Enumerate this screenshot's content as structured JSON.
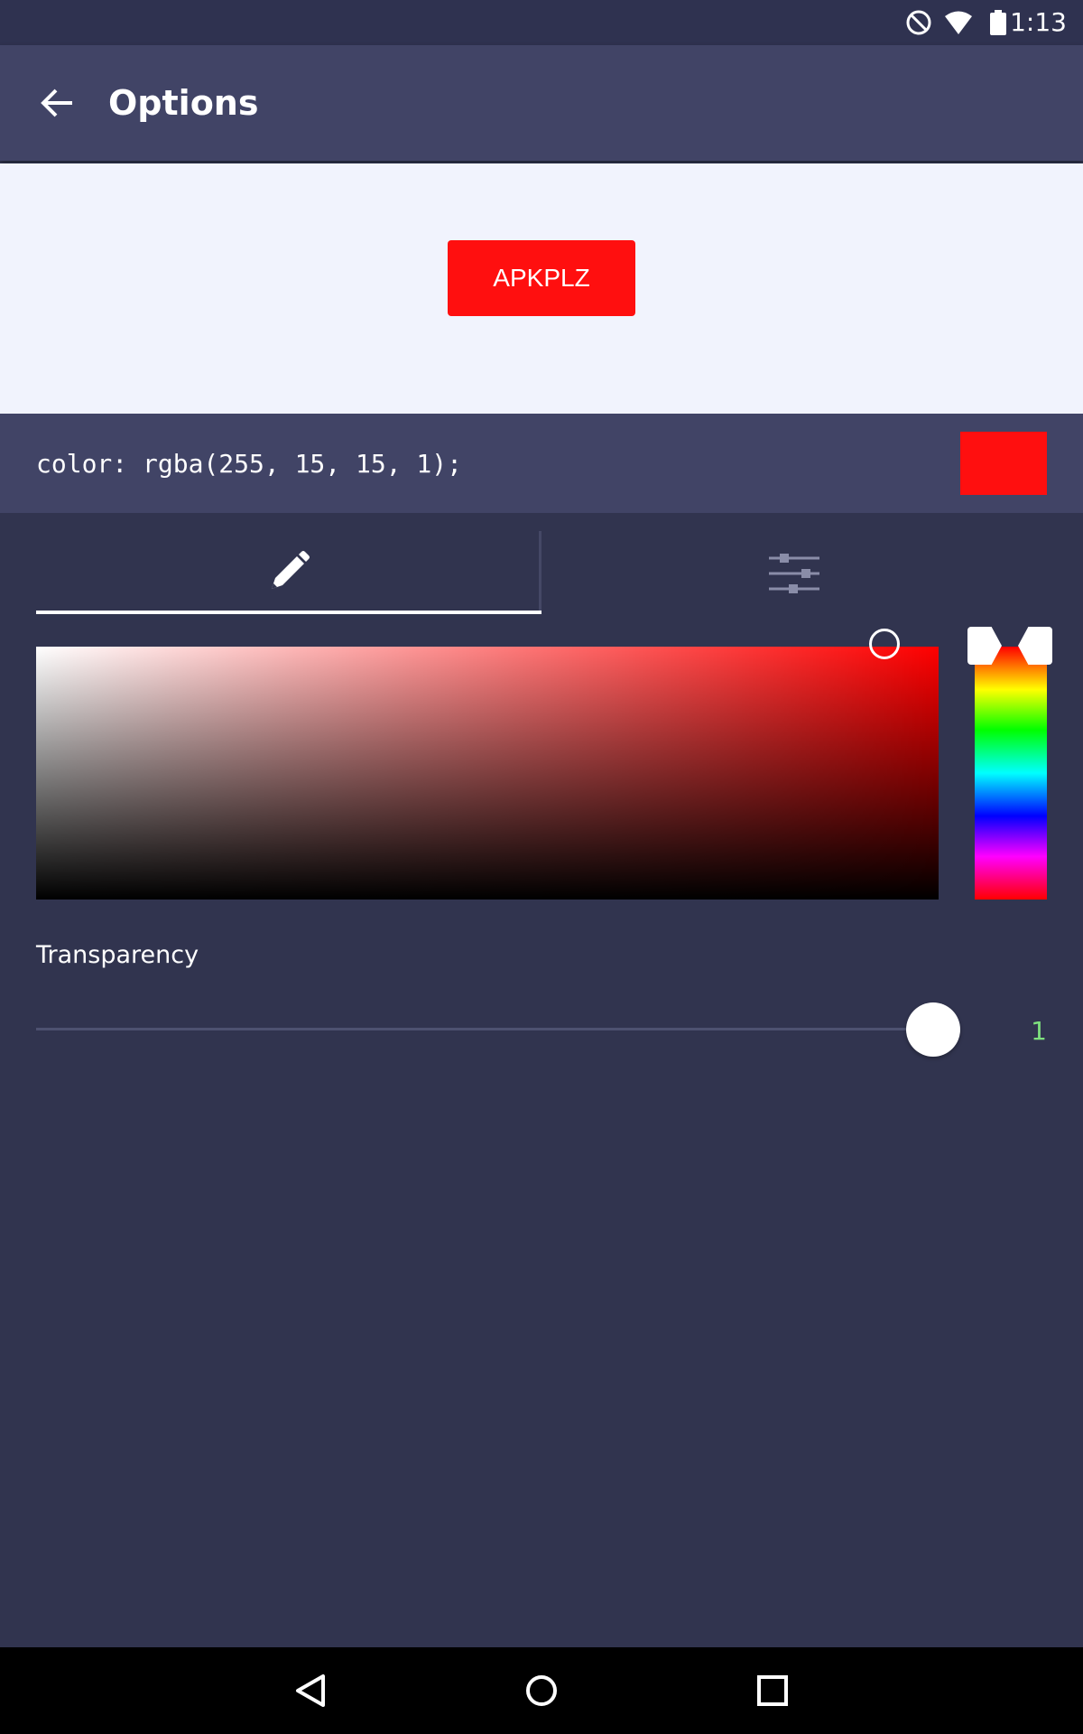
{
  "status_bar": {
    "time": "1:13",
    "icons": [
      "do-not-disturb-icon",
      "wifi-icon",
      "battery-icon"
    ]
  },
  "toolbar": {
    "title": "Options",
    "back_icon": "arrow-left-icon"
  },
  "preview": {
    "button_label": "APKPLZ",
    "button_color": "#ff0f0f",
    "background": "#f1f3fd"
  },
  "color_code": {
    "text": "color: rgba(255, 15, 15, 1);",
    "swatch_color": "#ff0f0f"
  },
  "tabs": [
    {
      "name": "picker",
      "icon": "pencil-icon",
      "selected": true
    },
    {
      "name": "sliders",
      "icon": "sliders-icon",
      "selected": false
    }
  ],
  "picker": {
    "hue_color": "#ff0000",
    "saturation": 0.94,
    "value": 1.0,
    "hue_position": 0.0
  },
  "transparency": {
    "label": "Transparency",
    "value": "1",
    "fraction": 1.0,
    "value_color": "#7ee07e"
  },
  "nav_bar": {
    "icons": [
      "back-triangle-icon",
      "home-circle-icon",
      "recents-square-icon"
    ]
  },
  "colors": {
    "background": "#31344f",
    "toolbar": "#414466",
    "status_bar": "#2f3250",
    "accent": "#ff0f0f"
  }
}
